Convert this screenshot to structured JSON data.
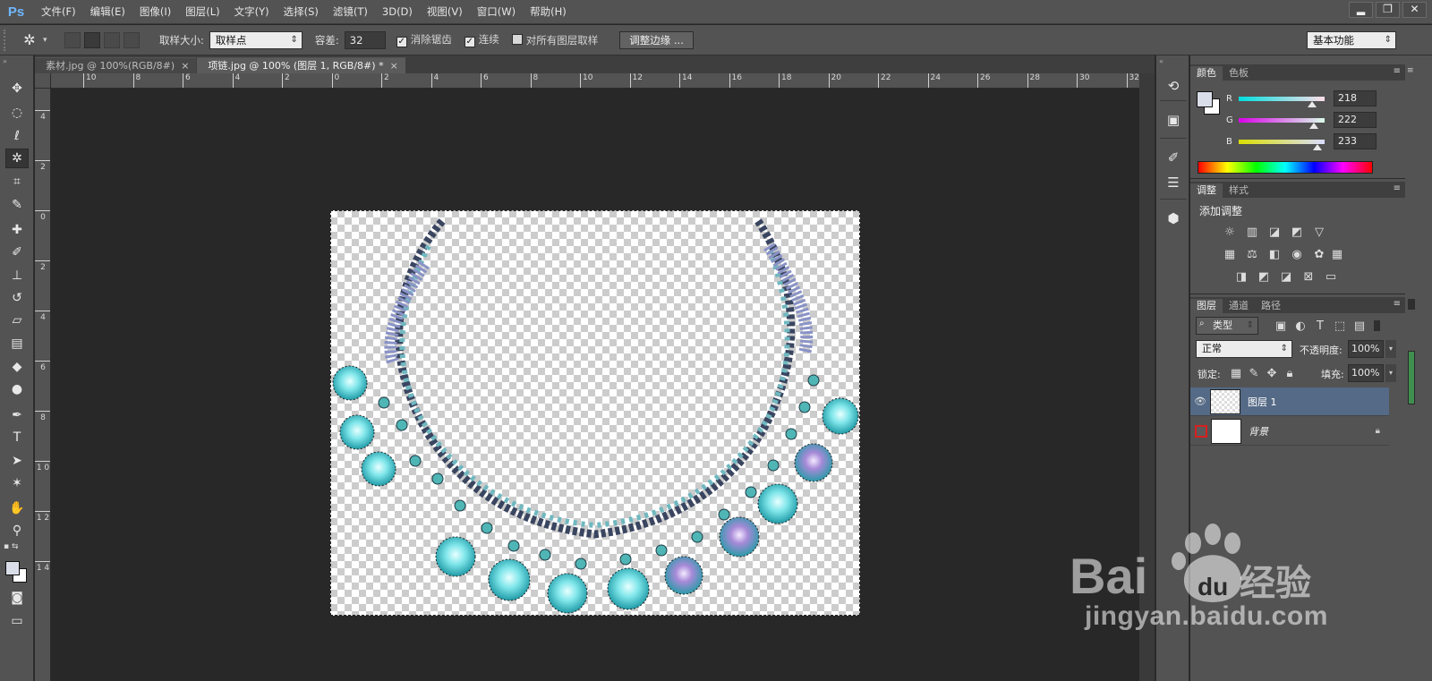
{
  "app": {
    "logo": "Ps"
  },
  "menu": [
    "文件(F)",
    "编辑(E)",
    "图像(I)",
    "图层(L)",
    "文字(Y)",
    "选择(S)",
    "滤镜(T)",
    "3D(D)",
    "视图(V)",
    "窗口(W)",
    "帮助(H)"
  ],
  "window_controls": {
    "minimize": "▂",
    "restore": "❐",
    "close": "✕"
  },
  "options": {
    "sample_size_label": "取样大小:",
    "sample_size_value": "取样点",
    "tolerance_label": "容差:",
    "tolerance_value": "32",
    "antialias_label": "消除锯齿",
    "antialias_checked": true,
    "contiguous_label": "连续",
    "contiguous_checked": true,
    "all_layers_label": "对所有图层取样",
    "all_layers_checked": false,
    "refine_edge_label": "调整边缘 ...",
    "workspace_value": "基本功能"
  },
  "tabs": [
    {
      "label": "素材.jpg @ 100%(RGB/8#)",
      "active": false,
      "close": "×"
    },
    {
      "label": "项链.jpg @ 100% (图层 1, RGB/8#) *",
      "active": true,
      "close": "×"
    }
  ],
  "ruler_h": [
    "10",
    "8",
    "6",
    "4",
    "2",
    "0",
    "2",
    "4",
    "6",
    "8",
    "10",
    "12",
    "14",
    "16",
    "18",
    "20",
    "22",
    "24",
    "26",
    "28",
    "30",
    "32"
  ],
  "ruler_v": [
    "4",
    "2",
    "0",
    "2",
    "4",
    "6",
    "8",
    "1 0",
    "1 2",
    "1 4"
  ],
  "color_panel": {
    "tabs": [
      "颜色",
      "色板"
    ],
    "r_label": "R",
    "g_label": "G",
    "b_label": "B",
    "r": "218",
    "g": "222",
    "b": "233",
    "r_level": 0.855,
    "g_level": 0.871,
    "b_level": 0.914
  },
  "adjust_panel": {
    "tabs": [
      "调整",
      "样式"
    ],
    "title": "添加调整"
  },
  "layers_panel": {
    "tabs": [
      "图层",
      "通道",
      "路径"
    ],
    "filter_kind": "类型",
    "blend_mode": "正常",
    "opacity_label": "不透明度:",
    "opacity_value": "100%",
    "lock_label": "锁定:",
    "fill_label": "填充:",
    "fill_value": "100%",
    "layers": [
      {
        "name": "图层 1",
        "selected": true
      },
      {
        "name": "背景",
        "selected": false
      }
    ]
  },
  "watermark": {
    "brand": "Bai",
    "du": "du",
    "suffix": "经验",
    "url": "jingyan.baidu.com"
  },
  "colors": {
    "accent": "#546a86",
    "highlight": "#d82020"
  },
  "icons": [
    "move-icon",
    "marquee-icon",
    "lasso-icon",
    "magic-wand-icon",
    "crop-icon",
    "eyedropper-icon",
    "healing-icon",
    "brush-icon",
    "stamp-icon",
    "history-brush-icon",
    "eraser-icon",
    "gradient-icon",
    "blur-icon",
    "dodge-icon",
    "pen-icon",
    "type-icon",
    "path-select-icon",
    "shape-icon",
    "hand-icon",
    "zoom-icon",
    "eye-icon",
    "lock-icon"
  ]
}
